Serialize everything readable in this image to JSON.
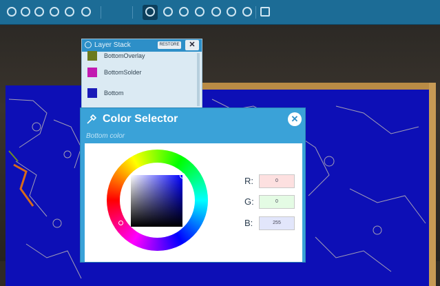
{
  "toolbar": {
    "icons": [
      "open-icon",
      "zoom-icon",
      "tool-icon",
      "settings-icon",
      "grid-icon",
      "layers-icon",
      "info-icon",
      "help-icon",
      "edit-icon",
      "close-icon",
      "undo-icon",
      "redo-icon",
      "view-icon"
    ]
  },
  "layer_stack": {
    "title": "Layer Stack",
    "button_label": "RESTORE",
    "close_label": "✕",
    "layers": [
      {
        "label": "BottomOverlay",
        "color": "#6b7a1c"
      },
      {
        "label": "BottomSolder",
        "color": "#c21ab1"
      },
      {
        "label": "Bottom",
        "color": "#1a1ab8"
      }
    ]
  },
  "color_selector": {
    "title": "Color Selector",
    "subtitle": "Bottom color",
    "close_label": "✕",
    "r_label": "R:",
    "g_label": "G:",
    "b_label": "B:",
    "r_value": "0",
    "g_value": "0",
    "b_value": "255",
    "r_bg": "#fde0e0",
    "g_bg": "#e4fbe4",
    "b_bg": "#e2e6fb"
  }
}
